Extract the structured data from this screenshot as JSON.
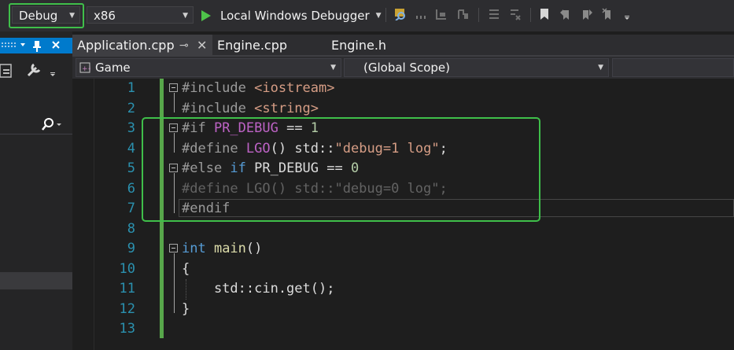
{
  "toolbar": {
    "configuration": "Debug",
    "platform": "x86",
    "run_label": "Local Windows Debugger"
  },
  "tabs": [
    {
      "label": "Application.cpp",
      "active": true
    },
    {
      "label": "Engine.cpp",
      "active": false
    },
    {
      "label": "Engine.h",
      "active": false
    }
  ],
  "navbar": {
    "project": "Game",
    "scope": "(Global Scope)"
  },
  "editor": {
    "line_numbers": [
      "1",
      "2",
      "3",
      "4",
      "5",
      "6",
      "7",
      "8",
      "9",
      "10",
      "11",
      "12",
      "13"
    ],
    "lines": [
      [
        {
          "t": "#include ",
          "c": "t-pre"
        },
        {
          "t": "<iostream>",
          "c": "t-str"
        }
      ],
      [
        {
          "t": "#include ",
          "c": "t-pre"
        },
        {
          "t": "<string>",
          "c": "t-str"
        }
      ],
      [
        {
          "t": "#if ",
          "c": "t-pre"
        },
        {
          "t": "PR_DEBUG",
          "c": "t-macro"
        },
        {
          "t": " == ",
          "c": "t-txt"
        },
        {
          "t": "1",
          "c": "t-num"
        }
      ],
      [
        {
          "t": "#define ",
          "c": "t-pre"
        },
        {
          "t": "LGO",
          "c": "t-macro"
        },
        {
          "t": "() std::",
          "c": "t-txt"
        },
        {
          "t": "\"debug=1 log\"",
          "c": "t-str"
        },
        {
          "t": ";",
          "c": "t-txt"
        }
      ],
      [
        {
          "t": "#else ",
          "c": "t-pre"
        },
        {
          "t": "if ",
          "c": "t-kw"
        },
        {
          "t": "PR_DEBUG == ",
          "c": "t-txt"
        },
        {
          "t": "0",
          "c": "t-num"
        }
      ],
      [
        {
          "t": "#define LGO() std::\"debug=0 log\";",
          "c": "t-pre dim"
        }
      ],
      [
        {
          "t": "#endif",
          "c": "t-pre"
        }
      ],
      [],
      [
        {
          "t": "int ",
          "c": "t-kw"
        },
        {
          "t": "main",
          "c": "t-fn"
        },
        {
          "t": "()",
          "c": "t-txt"
        }
      ],
      [
        {
          "t": "{",
          "c": "t-txt"
        }
      ],
      [
        {
          "t": "    std::cin.get();",
          "c": "t-txt"
        }
      ],
      [
        {
          "t": "}",
          "c": "t-txt"
        }
      ],
      []
    ]
  },
  "colors": {
    "accent": "#007acc",
    "highlight_green": "#3fbf4a",
    "change_bar": "#57a64a"
  }
}
